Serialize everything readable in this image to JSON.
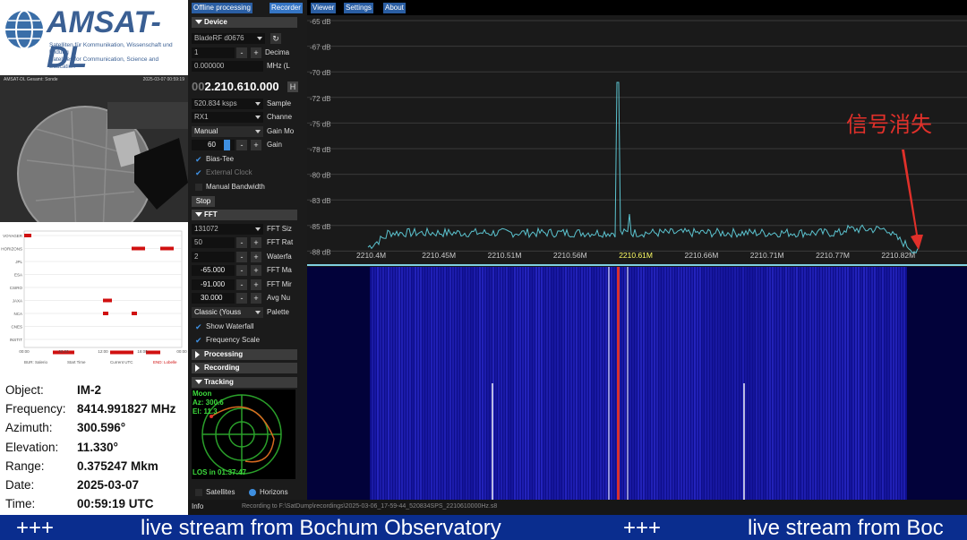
{
  "logo": {
    "name": "AMSAT-DL",
    "tagline1": "Satelliten für Kommunikation, Wissenschaft und Bildung",
    "tagline2": "Satellites for Communication, Science and Education"
  },
  "tabs": [
    "Offline processing",
    "Recorder",
    "Viewer",
    "Settings",
    "About"
  ],
  "device": {
    "title": "Device",
    "source": "BladeRF d0676",
    "decimation_value": "1",
    "decimation_label": "Decima",
    "offset": "0.000000",
    "offset_unit": "MHz (L",
    "frequency_prefix": "00",
    "frequency": "2.210.610.000",
    "frequency_unit_btn": "H",
    "samplerate": "520.834 ksps",
    "samplerate_label": "Sample",
    "channel": "RX1",
    "channel_label": "Channe",
    "gain_mode": "Manual",
    "gain_mode_label": "Gain Mo",
    "gain": "60",
    "gain_label": "Gain",
    "bias_tee": "Bias-Tee",
    "external_clock": "External Clock",
    "manual_bandwidth": "Manual Bandwidth",
    "stop": "Stop"
  },
  "fft": {
    "title": "FFT",
    "size": "131072",
    "size_label": "FFT Siz",
    "rate": "50",
    "rate_label": "FFT Rat",
    "waterfall_rate": "2",
    "waterfall_label": "Waterfa",
    "max": "-65.000",
    "max_label": "FFT Ma",
    "min": "-91.000",
    "min_label": "FFT Mir",
    "avg": "30.000",
    "avg_label": "Avg Nu",
    "palette": "Classic (Youss",
    "palette_label": "Palette",
    "show_waterfall": "Show Waterfall",
    "freq_scale": "Frequency Scale"
  },
  "sections": {
    "processing": "Processing",
    "recording": "Recording",
    "tracking": "Tracking",
    "satellites": "Satellites",
    "horizons": "Horizons",
    "info": "Info"
  },
  "tracking": {
    "name": "Moon",
    "az": "Az: 300.6",
    "el": "El: 11.3",
    "los": "LOS in 01:37:47"
  },
  "status": "Recording to F:\\SatDump\\recordings\\2025-03-06_17-59-44_520834SPS_2210610000Hz.s8",
  "spectrum": {
    "db_labels": [
      "-65 dB",
      "-67 dB",
      "-70 dB",
      "-72 dB",
      "-75 dB",
      "-78 dB",
      "-80 dB",
      "-83 dB",
      "-85 dB",
      "-88 dB"
    ],
    "freq_labels": [
      "2210.4M",
      "2210.45M",
      "2210.51M",
      "2210.56M",
      "2210.61M",
      "2210.66M",
      "2210.71M",
      "2210.77M",
      "2210.82M"
    ],
    "annotation": "信号消失",
    "colors": {
      "trace": "#5bc3cf",
      "center_label": "#ffff66",
      "arrow": "#e0302a"
    }
  },
  "camera": {
    "left": "AMSAT-DL Gesamt: Sonde",
    "right": "2025-03-07 00:59:19"
  },
  "schedule": {
    "rows": [
      "VOYAGER",
      "NEW HORIZONS",
      "JPL",
      "ESA",
      "CSIRO",
      "JAXA",
      "NCA",
      "CNES",
      "INSTIT"
    ],
    "xticks": [
      "00:00",
      "06:00",
      "12:00",
      "18:00",
      "00:00"
    ],
    "footer": [
      "BUR: Salerio",
      "Start Time",
      "Current UTC",
      "END: Lobelle"
    ]
  },
  "object": {
    "labels": {
      "object": "Object:",
      "frequency": "Frequency:",
      "azimuth": "Azimuth:",
      "elevation": "Elevation:",
      "range": "Range:",
      "date": "Date:",
      "time": "Time:"
    },
    "values": {
      "object": "IM-2",
      "frequency": "8414.991827 MHz",
      "azimuth": "300.596°",
      "elevation": "11.330°",
      "range": "0.375247 Mkm",
      "date": "2025-03-07",
      "time": "00:59:19 UTC"
    }
  },
  "ticker": [
    "+++",
    "live stream from Bochum Observatory",
    "+++",
    "live stream from Boc"
  ]
}
